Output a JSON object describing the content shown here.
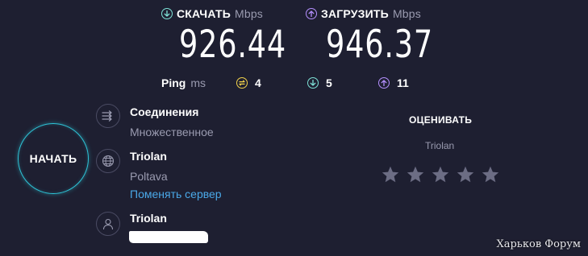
{
  "download": {
    "label": "СКАЧАТЬ",
    "unit": "Mbps",
    "value": "926.44"
  },
  "upload": {
    "label": "ЗАГРУЗИТЬ",
    "unit": "Mbps",
    "value": "946.37"
  },
  "ping": {
    "label": "Ping",
    "unit": "ms",
    "idle": "4",
    "download": "5",
    "upload": "11"
  },
  "start_button": {
    "label": "НАЧАТЬ"
  },
  "connections": {
    "title": "Соединения",
    "value": "Множественное"
  },
  "server": {
    "name": "Triolan",
    "location": "Poltava",
    "change_link": "Поменять сервер"
  },
  "provider": {
    "name": "Triolan"
  },
  "rating": {
    "title": "ОЦЕНИВАТЬ",
    "provider": "Triolan",
    "stars": 5,
    "filled": 0
  },
  "watermark": "Харьков Форум",
  "colors": {
    "background": "#1e1f31",
    "download_accent": "#7fe3d8",
    "upload_accent": "#b590ff",
    "ping_idle_accent": "#f2d24b",
    "start_ring": "#2ec5d8",
    "link": "#4aa8e8",
    "star": "#6c6d84"
  }
}
